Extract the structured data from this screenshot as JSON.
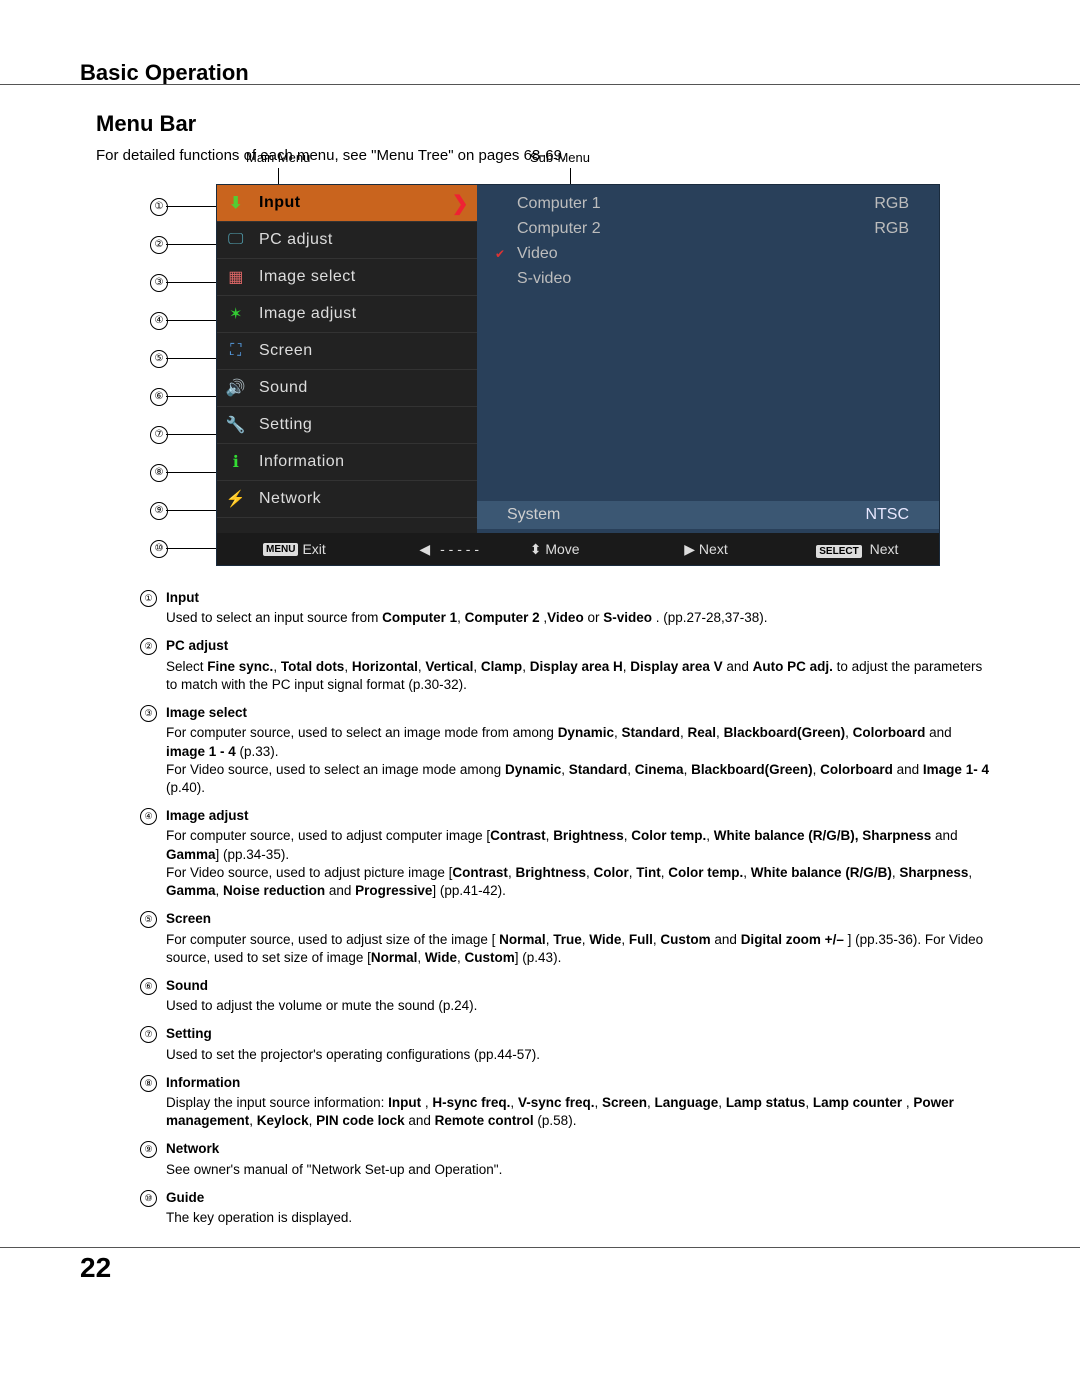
{
  "section_title": "Basic Operation",
  "sub_title": "Menu Bar",
  "intro": "For detailed functions of each menu, see \"Menu Tree\" on pages 68-69.",
  "labels": {
    "main_menu": "Main Menu",
    "sub_menu": "Sub-Menu"
  },
  "main_menu": {
    "items": [
      {
        "label": "Input",
        "glyph": "⬇",
        "selected": true
      },
      {
        "label": "PC adjust",
        "glyph": "🖵"
      },
      {
        "label": "Image select",
        "glyph": "▦"
      },
      {
        "label": "Image adjust",
        "glyph": "✶"
      },
      {
        "label": "Screen",
        "glyph": "⛶"
      },
      {
        "label": "Sound",
        "glyph": "🔊"
      },
      {
        "label": "Setting",
        "glyph": "🔧"
      },
      {
        "label": "Information",
        "glyph": "ℹ"
      },
      {
        "label": "Network",
        "glyph": "⚡"
      }
    ]
  },
  "sub_menu": {
    "items": [
      {
        "label": "Computer 1",
        "value": "RGB"
      },
      {
        "label": "Computer 2",
        "value": "RGB"
      },
      {
        "label": "Video",
        "value": "",
        "checked": true
      },
      {
        "label": "S-video",
        "value": ""
      }
    ],
    "system": {
      "label": "System",
      "value": "NTSC"
    }
  },
  "footer": {
    "exit_badge": "MENU",
    "exit": "Exit",
    "left_dashes": "- - - - -",
    "move": "Move",
    "next1": "Next",
    "select_badge": "SELECT",
    "next2": "Next"
  },
  "descriptions": [
    {
      "num": "①",
      "num_plain": "1",
      "title": "Input",
      "body": "Used to select an input source from <b>Computer 1</b>, <b>Computer 2</b> ,<b>Video</b> or <b>S-video</b> . (pp.27-28,37-38)."
    },
    {
      "num": "②",
      "num_plain": "2",
      "title": "PC adjust",
      "body": "Select <b>Fine sync.</b>, <b>Total dots</b>, <b>Horizontal</b>, <b>Vertical</b>, <b>Clamp</b>, <b>Display area H</b>, <b>Display area V</b> and <b>Auto PC adj.</b> to adjust the parameters to match with the PC input signal format (p.30-32)."
    },
    {
      "num": "③",
      "num_plain": "3",
      "title": "Image select",
      "body": "For computer source, used to select an image mode from among <b>Dynamic</b>, <b>Standard</b>, <b>Real</b>, <b>Blackboard(Green)</b>, <b>Colorboard</b> and <b>image 1 - 4</b> (p.33).<br>For Video source, used to select an image mode among <b>Dynamic</b>, <b>Standard</b>, <b>Cinema</b>, <b>Blackboard(Green)</b>, <b>Colorboard</b> and <b>Image 1- 4</b> (p.40)."
    },
    {
      "num": "④",
      "num_plain": "4",
      "title": "Image adjust",
      "body": "For computer source, used to adjust computer image [<b>Contrast</b>, <b>Brightness</b>, <b>Color temp.</b>, <b>White balance (R/G/B), Sharpness</b> and <b>Gamma</b>] (pp.34-35).<br>For Video source, used to adjust picture image [<b>Contrast</b>, <b>Brightness</b>, <b>Color</b>, <b>Tint</b>, <b>Color temp.</b>, <b>White balance (R/G/B)</b>, <b>Sharpness</b>, <b>Gamma</b>, <b>Noise reduction</b> and <b>Progressive</b>] (pp.41-42)."
    },
    {
      "num": "⑤",
      "num_plain": "5",
      "title": "Screen",
      "body": "For computer source, used to adjust size of the image [ <b>Normal</b>, <b>True</b>, <b>Wide</b>, <b>Full</b>, <b>Custom</b> and <b>Digital zoom +/–</b> ] (pp.35-36). For Video source, used to set size of image [<b>Normal</b>, <b>Wide</b>, <b>Custom</b>] (p.43)."
    },
    {
      "num": "⑥",
      "num_plain": "6",
      "title": "Sound",
      "body": "Used to adjust the volume or mute the sound (p.24)."
    },
    {
      "num": "⑦",
      "num_plain": "7",
      "title": "Setting",
      "body": "Used to set the projector's operating configurations (pp.44-57)."
    },
    {
      "num": "⑧",
      "num_plain": "8",
      "title": "Information",
      "body": "Display the input source information: <b>Input</b> , <b>H-sync freq.</b>, <b>V-sync freq.</b>, <b>Screen</b>, <b>Language</b>, <b>Lamp status</b>, <b>Lamp counter</b> , <b>Power management</b>, <b>Keylock</b>, <b>PIN code lock</b> and <b>Remote control</b> (p.58)."
    },
    {
      "num": "⑨",
      "num_plain": "9",
      "title": "Network",
      "body": "See owner's manual of \"Network Set-up and Operation\"."
    },
    {
      "num": "⑩",
      "num_plain": "10",
      "title": "Guide",
      "body": "The key operation is displayed."
    }
  ],
  "page_number": "22"
}
